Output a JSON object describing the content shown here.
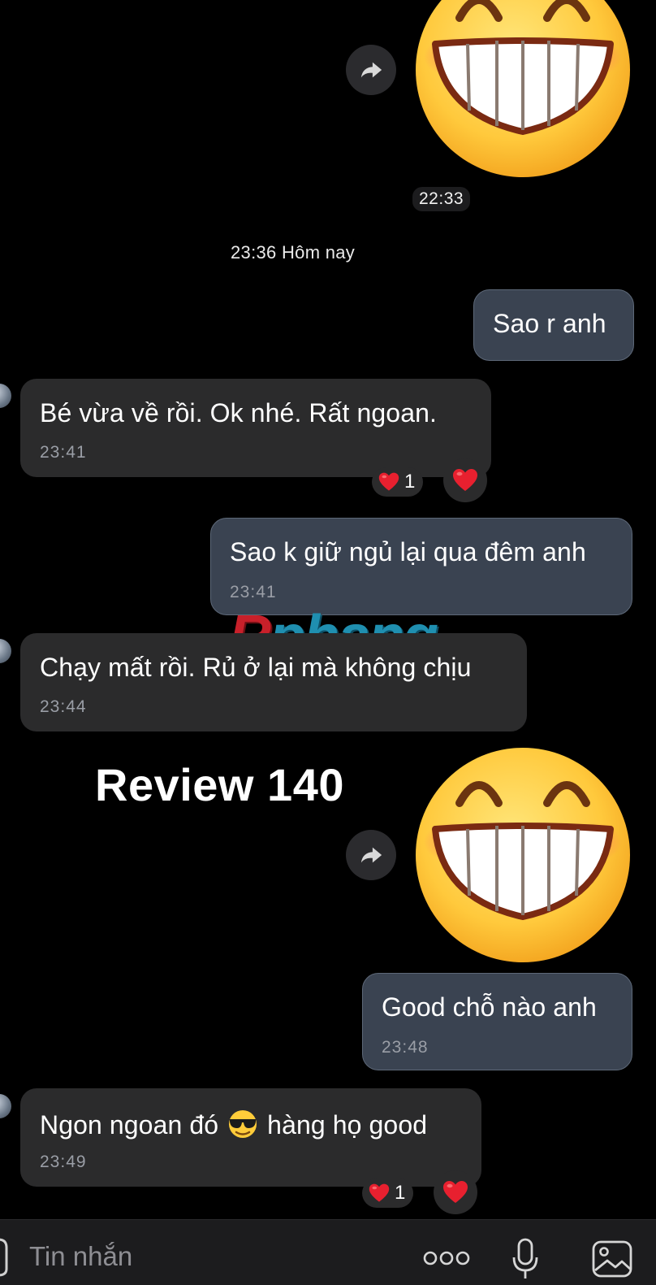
{
  "watermark": {
    "first": "R",
    "rest": "phang"
  },
  "review_label": "Review 140",
  "day_separator": "23:36 Hôm nay",
  "sticker1": {
    "time": "22:33"
  },
  "messages": [
    {
      "text": "Sao r anh"
    },
    {
      "text": "Bé vừa về rồi. Ok nhé. Rất ngoan.",
      "time": "23:41",
      "reaction_count": "1"
    },
    {
      "text": "Sao k giữ ngủ lại qua đêm anh",
      "time": "23:41"
    },
    {
      "text": "Chạy mất rồi. Rủ ở lại mà không chịu",
      "time": "23:44"
    },
    {
      "text": "Good chỗ nào anh",
      "time": "23:48"
    },
    {
      "text_before": "Ngon ngoan đó",
      "text_after": "hàng họ good",
      "time": "23:49",
      "reaction_count": "1"
    }
  ],
  "input": {
    "placeholder": "Tin nhắn"
  },
  "icons": {
    "forward": "forward-arrow-icon",
    "heart": "heart-icon",
    "sunglasses": "sunglasses-emoji-icon",
    "more": "more-dots-icon",
    "mic": "microphone-icon",
    "gallery": "image-gallery-icon",
    "attach": "attach-icon"
  },
  "colors": {
    "background": "#000000",
    "outgoing_bubble": "#3a4351",
    "incoming_bubble": "#2b2b2c",
    "heart": "#e8202f"
  }
}
